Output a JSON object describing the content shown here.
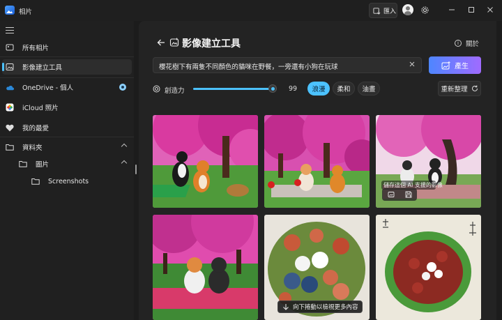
{
  "window": {
    "title": "相片"
  },
  "titlebar": {
    "import_label": "匯入"
  },
  "sidebar": {
    "items": [
      {
        "label": "所有相片"
      },
      {
        "label": "影像建立工具"
      },
      {
        "label": "OneDrive - 個人"
      },
      {
        "label": "iCloud 照片"
      },
      {
        "label": "我的最愛"
      },
      {
        "label": "資料夾"
      },
      {
        "label": "圖片"
      },
      {
        "label": "Screenshots"
      }
    ]
  },
  "header": {
    "title": "影像建立工具",
    "about_label": "關於"
  },
  "prompt": {
    "text": "櫻花樹下有兩隻不同顏色的貓咪在野餐，一旁還有小狗在玩球",
    "generate_label": "產生"
  },
  "controls": {
    "creativity_label": "創造力",
    "creativity_value": "99",
    "creativity_level": 0.99,
    "styles": [
      "浪漫",
      "柔和",
      "油畫"
    ],
    "selected_style": "浪漫",
    "refresh_label": "重新整理"
  },
  "gallery": {
    "tooltip": "儲存這個 AI 支援的影像",
    "scroll_hint": "向下捲動以檢視更多內容"
  },
  "colors": {
    "accent": "#4cc2ff",
    "generate_start": "#4e86ff",
    "generate_end": "#a06bff"
  }
}
